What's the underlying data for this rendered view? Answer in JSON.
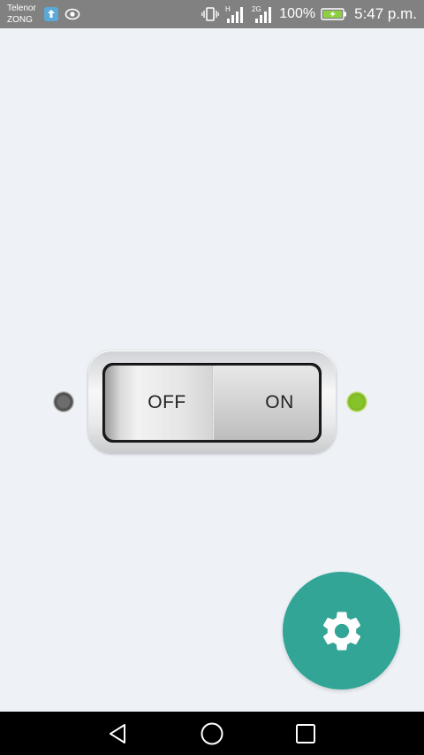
{
  "status_bar": {
    "carrier_1": "Telenor",
    "carrier_2": "ZONG",
    "network_1": "H",
    "network_2": "2G",
    "battery_percent": "100%",
    "time": "5:47 p.m."
  },
  "switch": {
    "off_label": "OFF",
    "on_label": "ON",
    "state": "on"
  },
  "fab": {
    "icon": "gear-icon"
  },
  "navigation": {
    "back_icon": "back-triangle-icon",
    "home_icon": "home-circle-icon",
    "recent_icon": "recent-apps-square-icon"
  },
  "colors": {
    "background": "#eef2f6",
    "status_bar": "#818181",
    "fab": "#32a596",
    "indicator_on": "#86c32a",
    "indicator_off": "#5a5a5a",
    "nav_bar": "#000000",
    "battery": "#8ccf3f"
  }
}
